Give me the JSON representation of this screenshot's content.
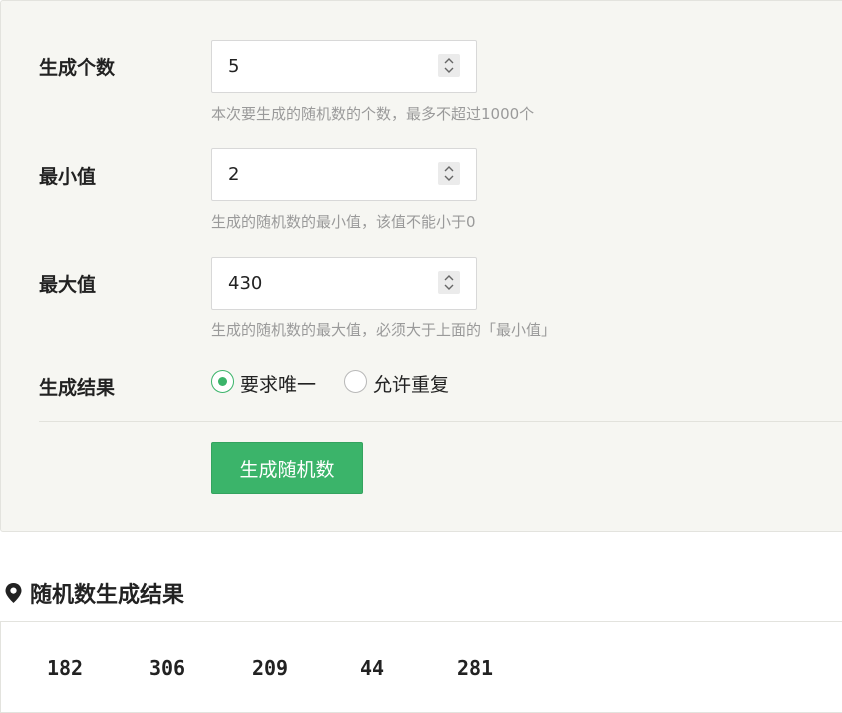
{
  "form": {
    "count": {
      "label": "生成个数",
      "value": "5",
      "hint": "本次要生成的随机数的个数，最多不超过1000个"
    },
    "min": {
      "label": "最小值",
      "value": "2",
      "hint": "生成的随机数的最小值，该值不能小于0"
    },
    "max": {
      "label": "最大值",
      "value": "430",
      "hint": "生成的随机数的最大值，必须大于上面的「最小值」"
    },
    "result_mode": {
      "label": "生成结果",
      "options": [
        {
          "label": "要求唯一",
          "checked": true
        },
        {
          "label": "允许重复",
          "checked": false
        }
      ]
    },
    "generate_button": "生成随机数"
  },
  "result": {
    "title": "随机数生成结果",
    "icon": "map-pin-icon",
    "numbers": [
      "182",
      "306",
      "209",
      "44",
      "281"
    ]
  },
  "colors": {
    "accent": "#3bb46a",
    "panel_bg": "#f6f6f2",
    "hint_text": "#9a9a9a"
  }
}
